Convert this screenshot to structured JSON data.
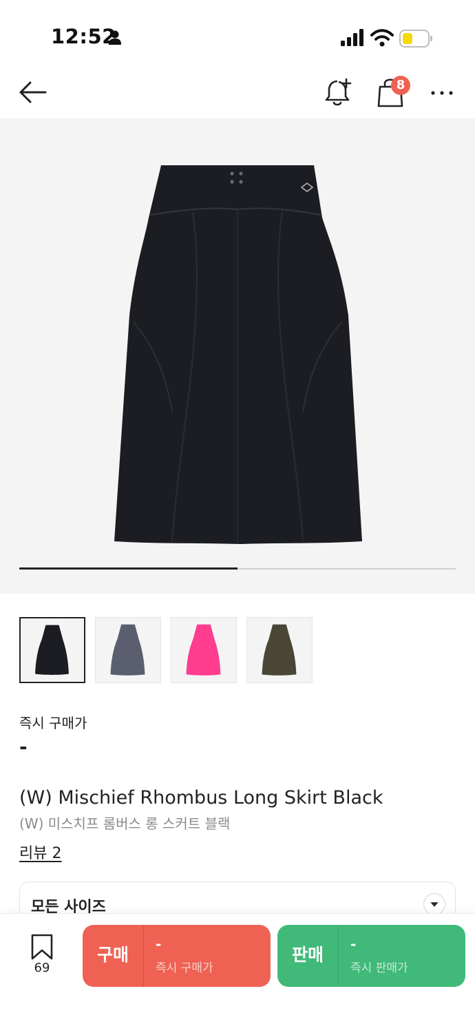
{
  "status_bar": {
    "time": "12:52"
  },
  "nav": {
    "cart_badge": "8"
  },
  "hero": {
    "slide_progress": 0.5
  },
  "thumbnails": [
    {
      "color_name": "black",
      "color": "#1c1d22"
    },
    {
      "color_name": "grey",
      "color": "#5a5e6e"
    },
    {
      "color_name": "pink",
      "color": "#ff3d8f"
    },
    {
      "color_name": "khaki camo",
      "color": "#4a4636"
    }
  ],
  "product": {
    "price_label": "즉시 구매가",
    "price_value": "-",
    "title_en": "(W) Mischief Rhombus Long Skirt Black",
    "title_ko": "(W) 미스치프 롬버스 롱 스커트 블랙",
    "review_link": "리뷰 2"
  },
  "size_select": {
    "label": "모든 사이즈"
  },
  "bottom_bar": {
    "wish_count": "69",
    "buy": {
      "label": "구매",
      "price": "-",
      "sub": "즉시 구매가"
    },
    "sell": {
      "label": "판매",
      "price": "-",
      "sub": "즉시 판매가"
    }
  },
  "colors": {
    "buy": "#ef6253",
    "sell": "#41b979",
    "badge": "#ef6253",
    "battery": "#f5d90a"
  }
}
